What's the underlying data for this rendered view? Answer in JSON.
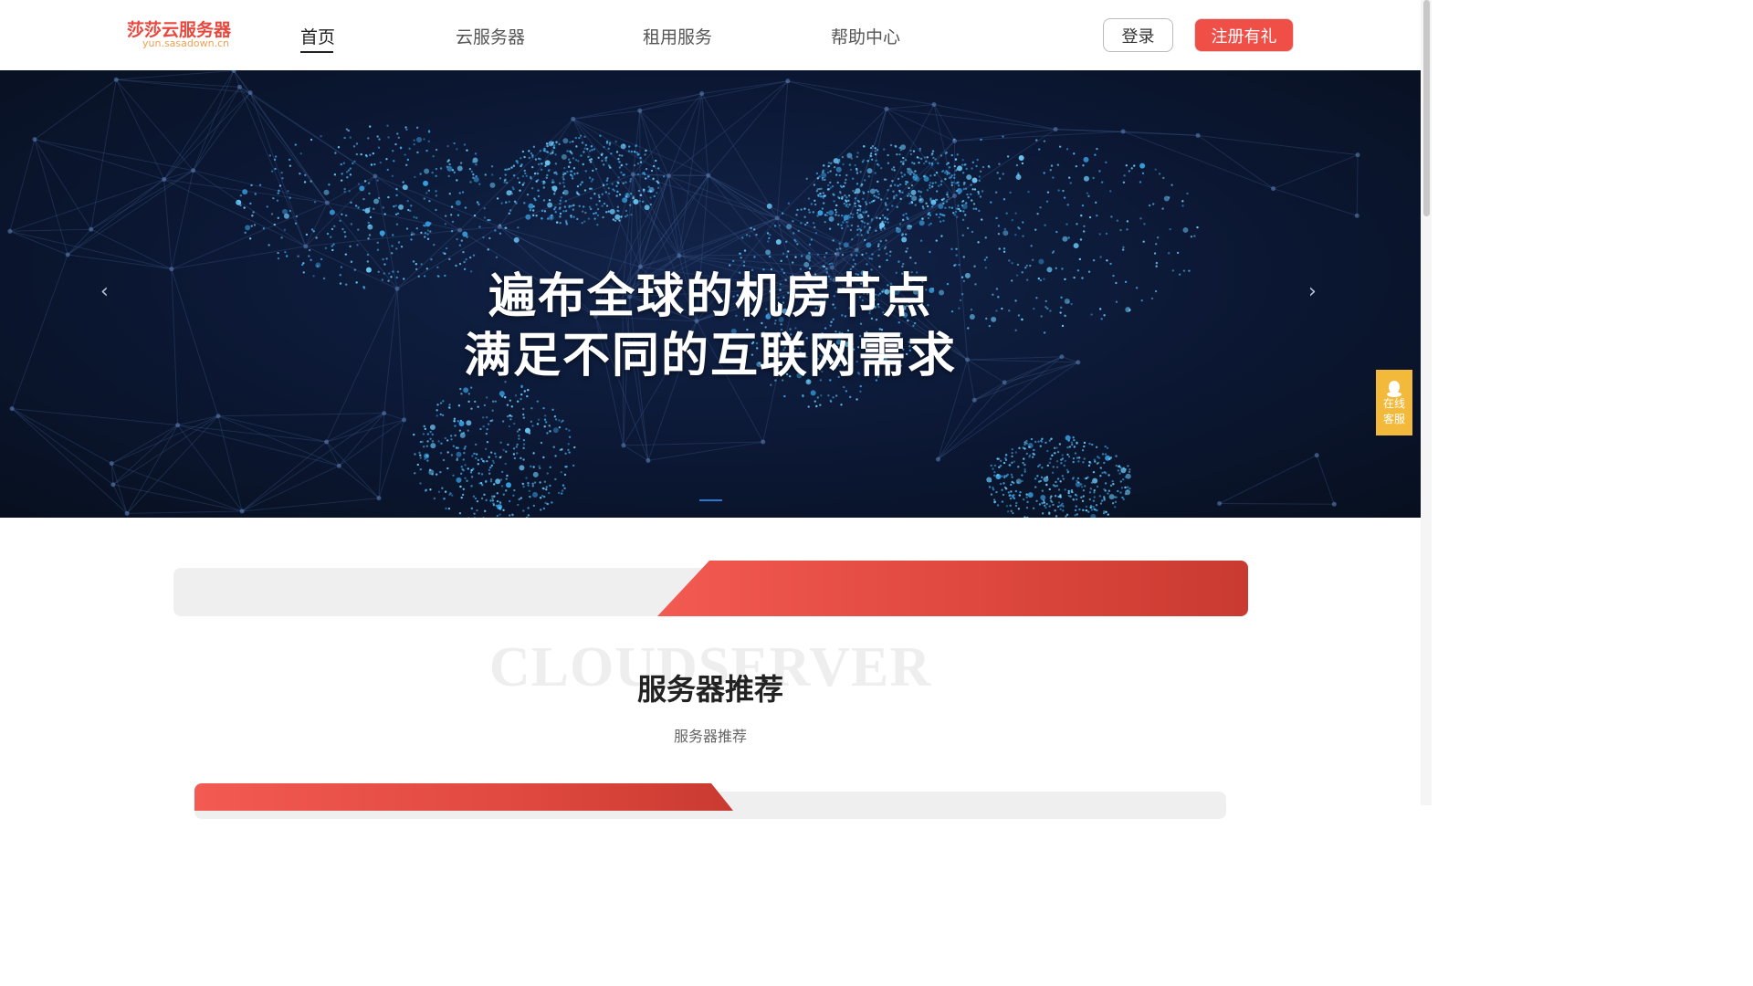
{
  "header": {
    "logo_text": "莎莎云服务器",
    "logo_domain": "yun.sasadown.cn",
    "nav": [
      {
        "label": "首页",
        "active": true
      },
      {
        "label": "云服务器",
        "active": false
      },
      {
        "label": "租用服务",
        "active": false
      },
      {
        "label": "帮助中心",
        "active": false
      }
    ],
    "login_label": "登录",
    "register_label": "注册有礼"
  },
  "banner": {
    "line1": "遍布全球的机房节点",
    "line2": "满足不同的互联网需求",
    "prev_icon": "chevron-left-icon",
    "next_icon": "chevron-right-icon",
    "slide_count": 1,
    "active_slide": 1,
    "accent_color": "#2a76d6"
  },
  "side_service": {
    "icon": "qq-penguin-icon",
    "line1": "在线",
    "line2": "客服",
    "color": "#f2b93b"
  },
  "section": {
    "bg_word": "CLOUDSERVER",
    "title": "服务器推荐",
    "subtitle": "服务器推荐"
  },
  "colors": {
    "brand_red": "#ef4f47",
    "tab_gray": "#efefef"
  }
}
